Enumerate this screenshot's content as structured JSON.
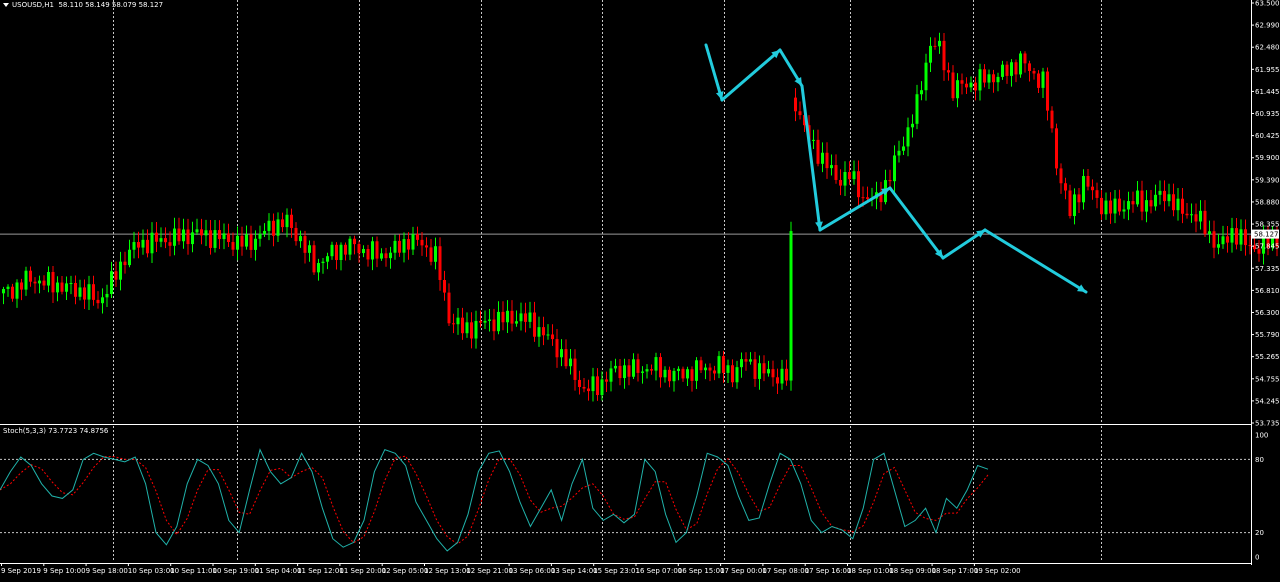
{
  "chart_title": {
    "symbol": "USOUSD,H1",
    "ohlc": "58.110 58.149 58.079 58.127"
  },
  "stoch_title": {
    "name": "Stoch(5,3,3)",
    "values": "73.7723 74.8756"
  },
  "colors": {
    "background": "#000000",
    "up_candle": "#00ff00",
    "down_candle": "#ff0000",
    "grid": "#c8c8c8",
    "stoch_main": "#20b2aa",
    "stoch_signal": "#ff0000",
    "arrows": "#22ccdd",
    "current_price_line": "#9a9a9a"
  },
  "chart_data": [
    {
      "type": "candlestick",
      "symbol": "USOUSD",
      "timeframe": "H1",
      "current_price": 58.127,
      "y_ticks": [
        "63.500",
        "62.990",
        "62.480",
        "61.955",
        "61.445",
        "60.935",
        "60.425",
        "59.900",
        "59.390",
        "58.880",
        "58.355",
        "57.845",
        "57.335",
        "56.810",
        "56.300",
        "55.790",
        "55.265",
        "54.755",
        "54.245",
        "53.735"
      ],
      "x_ticks": [
        "9 Sep 2019",
        "9 Sep 10:00",
        "9 Sep 18:00",
        "10 Sep 03:00",
        "10 Sep 11:00",
        "10 Sep 19:00",
        "11 Sep 04:00",
        "11 Sep 12:00",
        "11 Sep 20:00",
        "12 Sep 05:00",
        "12 Sep 13:00",
        "12 Sep 21:00",
        "13 Sep 06:00",
        "13 Sep 14:00",
        "15 Sep 23:01",
        "16 Sep 07:00",
        "16 Sep 15:00",
        "17 Sep 00:00",
        "17 Sep 08:00",
        "17 Sep 16:00",
        "18 Sep 01:00",
        "18 Sep 09:00",
        "18 Sep 17:00",
        "19 Sep 02:00"
      ],
      "ylim": [
        53.735,
        63.5
      ],
      "close_path": [
        [
          0,
          56.75
        ],
        [
          3,
          56.9
        ],
        [
          6,
          57.1
        ],
        [
          9,
          57.0
        ],
        [
          12,
          56.95
        ],
        [
          15,
          56.85
        ],
        [
          18,
          56.8
        ],
        [
          21,
          56.55
        ],
        [
          24,
          57.0
        ],
        [
          27,
          57.6
        ],
        [
          30,
          57.9
        ],
        [
          33,
          57.95
        ],
        [
          36,
          58.0
        ],
        [
          39,
          58.05
        ],
        [
          42,
          58.15
        ],
        [
          45,
          58.1
        ],
        [
          48,
          58.05
        ],
        [
          51,
          57.95
        ],
        [
          54,
          57.9
        ],
        [
          57,
          58.1
        ],
        [
          60,
          58.35
        ],
        [
          63,
          58.4
        ],
        [
          66,
          58.0
        ],
        [
          69,
          57.4
        ],
        [
          72,
          57.6
        ],
        [
          75,
          57.8
        ],
        [
          78,
          57.85
        ],
        [
          81,
          57.7
        ],
        [
          84,
          57.65
        ],
        [
          87,
          57.75
        ],
        [
          90,
          58.0
        ],
        [
          93,
          57.9
        ],
        [
          96,
          57.6
        ],
        [
          99,
          56.2
        ],
        [
          102,
          55.9
        ],
        [
          105,
          56.0
        ],
        [
          108,
          56.1
        ],
        [
          111,
          56.15
        ],
        [
          114,
          56.2
        ],
        [
          117,
          56.1
        ],
        [
          120,
          55.8
        ],
        [
          123,
          55.5
        ],
        [
          126,
          55.0
        ],
        [
          129,
          54.5
        ],
        [
          132,
          54.6
        ],
        [
          135,
          54.9
        ],
        [
          138,
          55.0
        ],
        [
          141,
          54.95
        ],
        [
          144,
          55.05
        ],
        [
          147,
          54.9
        ],
        [
          150,
          54.85
        ],
        [
          153,
          54.95
        ],
        [
          156,
          55.0
        ],
        [
          159,
          55.05
        ],
        [
          162,
          54.9
        ],
        [
          165,
          55.2
        ],
        [
          168,
          54.95
        ],
        [
          171,
          54.85
        ],
        [
          174,
          54.8
        ],
        [
          176,
          61.2
        ],
        [
          179,
          60.3
        ],
        [
          182,
          59.9
        ],
        [
          185,
          59.4
        ],
        [
          188,
          59.5
        ],
        [
          191,
          59.0
        ],
        [
          194,
          58.9
        ],
        [
          197,
          59.5
        ],
        [
          200,
          60.3
        ],
        [
          203,
          61.1
        ],
        [
          206,
          62.6
        ],
        [
          208,
          62.4
        ],
        [
          211,
          61.5
        ],
        [
          214,
          61.6
        ],
        [
          217,
          61.7
        ],
        [
          220,
          61.8
        ],
        [
          223,
          61.9
        ],
        [
          226,
          62.2
        ],
        [
          228,
          61.9
        ],
        [
          231,
          61.7
        ],
        [
          234,
          59.8
        ],
        [
          237,
          58.6
        ],
        [
          240,
          59.4
        ],
        [
          243,
          58.9
        ],
        [
          246,
          58.7
        ],
        [
          249,
          58.8
        ],
        [
          252,
          58.9
        ],
        [
          255,
          58.85
        ],
        [
          258,
          59.1
        ],
        [
          261,
          58.7
        ],
        [
          264,
          58.6
        ],
        [
          267,
          58.3
        ],
        [
          270,
          57.8
        ],
        [
          273,
          58.2
        ],
        [
          276,
          57.9
        ],
        [
          279,
          57.8
        ],
        [
          282,
          58.0
        ],
        [
          285,
          58.12
        ]
      ],
      "stoch_main": [
        55,
        70,
        82,
        75,
        60,
        50,
        48,
        55,
        80,
        85,
        82,
        80,
        78,
        82,
        60,
        20,
        10,
        25,
        60,
        80,
        75,
        60,
        30,
        20,
        55,
        88,
        70,
        60,
        65,
        85,
        70,
        40,
        15,
        8,
        12,
        30,
        70,
        88,
        85,
        75,
        45,
        30,
        15,
        5,
        12,
        35,
        70,
        85,
        87,
        70,
        45,
        25,
        40,
        55,
        30,
        60,
        80,
        40,
        30,
        35,
        28,
        35,
        80,
        70,
        35,
        12,
        20,
        50,
        85,
        82,
        75,
        50,
        30,
        32,
        60,
        85,
        80,
        60,
        30,
        20,
        25,
        22,
        15,
        40,
        80,
        85,
        55,
        25,
        30,
        40,
        20,
        48,
        40,
        55,
        75,
        72
      ]
    }
  ]
}
